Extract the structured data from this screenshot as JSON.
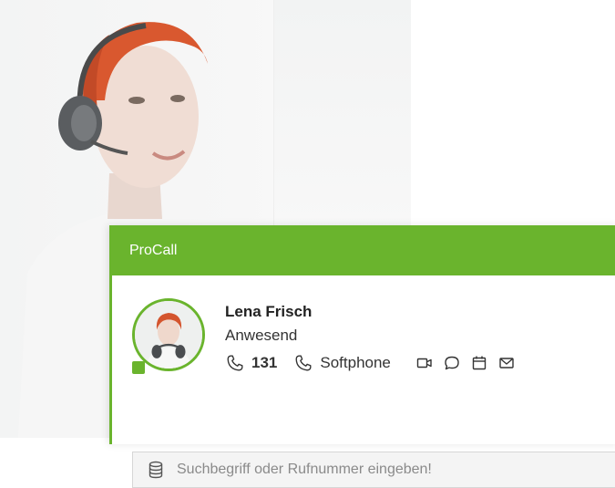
{
  "app": {
    "title": "ProCall"
  },
  "contact": {
    "name": "Lena Frisch",
    "status": "Anwesend",
    "extension": "131",
    "device": "Softphone"
  },
  "search": {
    "placeholder": "Suchbegriff oder Rufnummer eingeben!"
  },
  "icons": [
    "phone-icon",
    "softphone-icon",
    "video-icon",
    "chat-icon",
    "calendar-icon",
    "mail-icon",
    "database-icon"
  ],
  "colors": {
    "accent": "#6ab42d",
    "title_text": "#ffffff"
  }
}
